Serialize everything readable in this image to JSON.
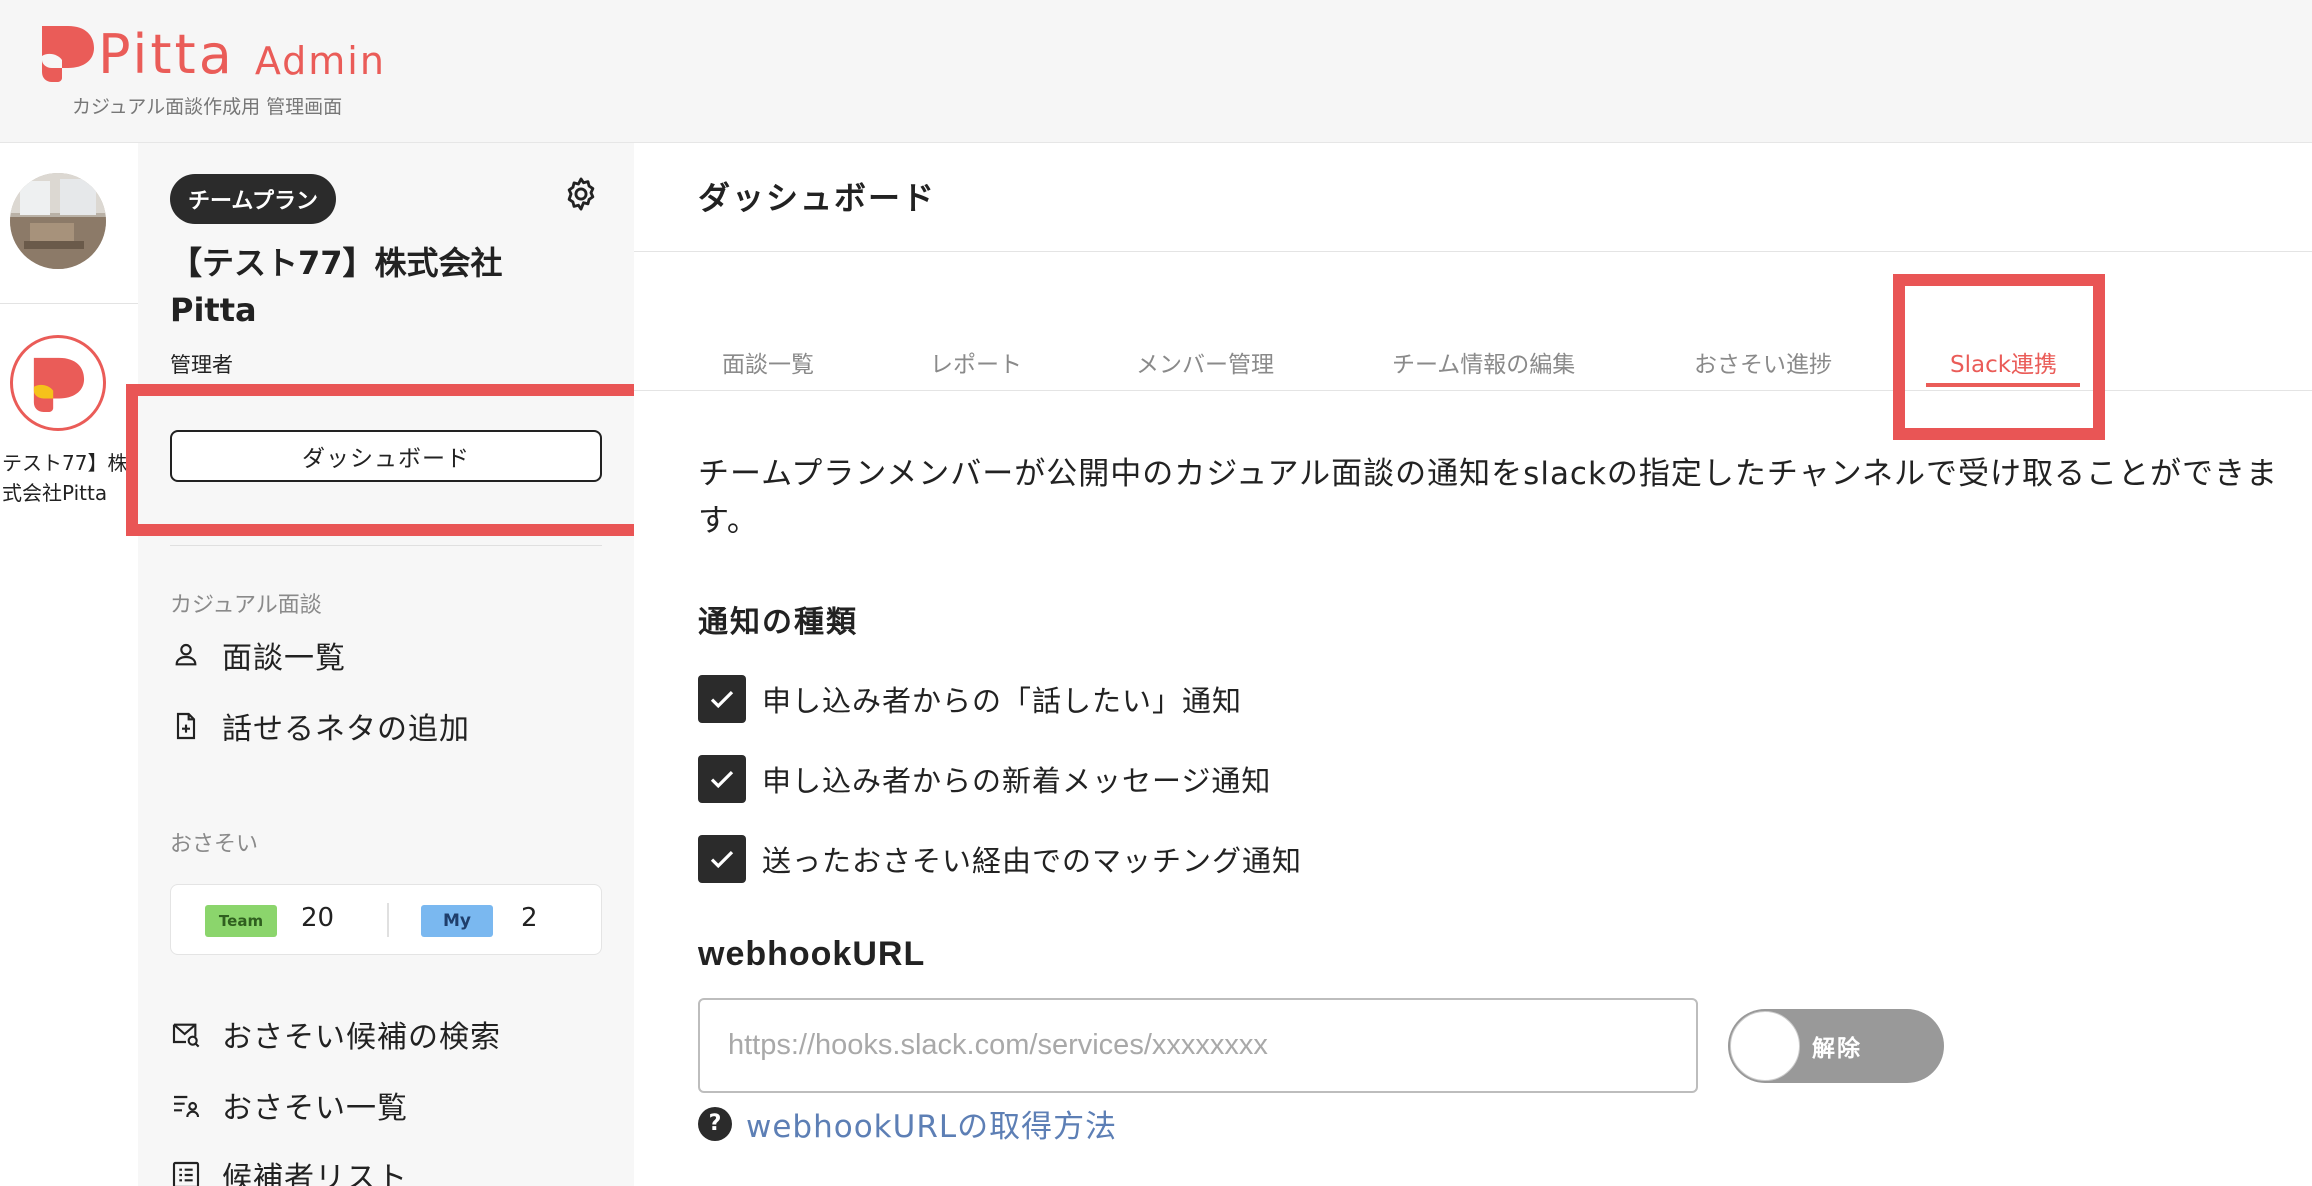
{
  "header": {
    "logo_text": "Pitta",
    "logo_admin": "Admin",
    "subtitle": "カジュアル面談作成用 管理画面",
    "brand_color": "#ea5c58"
  },
  "rail": {
    "team_name_line1": "テスト77】株",
    "team_name_line2": "式会社Pitta"
  },
  "sidebar": {
    "plan_badge": "チームプラン",
    "team_title": "【テスト77】株式会社Pitta",
    "role": "管理者",
    "dashboard_button": "ダッシュボード",
    "section_casual": "カジュアル面談",
    "items_casual": [
      {
        "label": "面談一覧",
        "icon": "person-icon"
      },
      {
        "label": "話せるネタの追加",
        "icon": "file-add-icon"
      }
    ],
    "section_osasoi": "おさそい",
    "osasoi": {
      "team_label": "Team",
      "team_count": "20",
      "my_label": "My",
      "my_count": "2"
    },
    "items_osasoi": [
      {
        "label": "おさそい候補の検索",
        "icon": "mail-search-icon"
      },
      {
        "label": "おさそい一覧",
        "icon": "list-person-icon"
      },
      {
        "label": "候補者リスト",
        "icon": "list-icon"
      }
    ]
  },
  "main": {
    "title": "ダッシュボード",
    "tabs": [
      {
        "label": "面談一覧",
        "active": false
      },
      {
        "label": "レポート",
        "active": false
      },
      {
        "label": "メンバー管理",
        "active": false
      },
      {
        "label": "チーム情報の編集",
        "active": false
      },
      {
        "label": "おさそい進捗",
        "active": false
      },
      {
        "label": "Slack連携",
        "active": true
      }
    ],
    "description": "チームプランメンバーが公開中のカジュアル面談の通知をslackの指定したチャンネルで受け取ることができます。",
    "notif_heading": "通知の種類",
    "checks": [
      {
        "label": "申し込み者からの「話したい」通知",
        "checked": true
      },
      {
        "label": "申し込み者からの新着メッセージ通知",
        "checked": true
      },
      {
        "label": "送ったおさそい経由でのマッチング通知",
        "checked": true
      }
    ],
    "webhook_heading": "webhookURL",
    "webhook_placeholder": "https://hooks.slack.com/services/xxxxxxxx",
    "webhook_value": "",
    "toggle_label": "解除",
    "help_link": "webhookURLの取得方法"
  },
  "colors": {
    "accent": "#ea5c58",
    "highlight": "#e95555",
    "dark": "#2b2b2b",
    "link": "#5d7fb5"
  }
}
